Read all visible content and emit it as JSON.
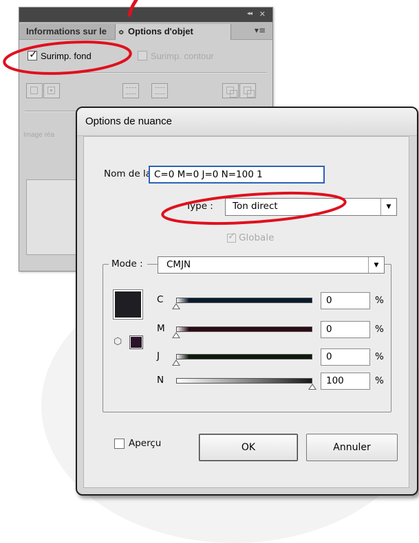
{
  "panel": {
    "collapse_glyph": "◂◂",
    "close_glyph": "✕",
    "tab_info_label": "Informations sur le",
    "tab_options_label": "Options d'objet",
    "tab_arrows": "≎",
    "menu_glyph": "▾≡",
    "overprint_fill_label": "Surimp. fond",
    "overprint_fill_checked": true,
    "overprint_stroke_label": "Surimp. contour",
    "overprint_stroke_checked": false,
    "image_label": "Image réa",
    "check_glyph": "✓"
  },
  "dialog": {
    "title": "Options de nuance",
    "swatch_name_label": "Nom de la nuance :",
    "swatch_name_value": "C=0 M=0 J=0 N=100 1",
    "type_label": "Type :",
    "type_value": "Ton direct",
    "global_label": "Globale",
    "global_checked": true,
    "mode_label": "Mode :",
    "mode_value": "CMJN",
    "dropdown_glyph": "▼",
    "cube_glyph": "⬡",
    "sliders": [
      {
        "label": "C",
        "value": "0",
        "unit": "%",
        "level": 0,
        "color": "#0a1a2e"
      },
      {
        "label": "M",
        "value": "0",
        "unit": "%",
        "level": 0,
        "color": "#2b0b14"
      },
      {
        "label": "J",
        "value": "0",
        "unit": "%",
        "level": 0,
        "color": "#0d1a0b"
      },
      {
        "label": "N",
        "value": "100",
        "unit": "%",
        "level": 100,
        "color": "#1a1a1a"
      }
    ],
    "preview_label": "Aperçu",
    "preview_checked": false,
    "ok_label": "OK",
    "cancel_label": "Annuler"
  },
  "colors": {
    "annotation_red": "#e0101e",
    "focus_blue": "#2a62b8",
    "current_color": "#1f1f23"
  }
}
